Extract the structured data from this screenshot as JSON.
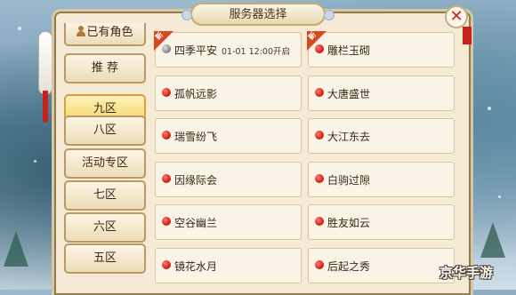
{
  "header": {
    "title": "服务器选择"
  },
  "close_symbol": "✕",
  "tabs": [
    {
      "label": "已有角色",
      "icon": "person-icon"
    },
    {
      "label": "推  荐"
    },
    {
      "label": "九区",
      "selected": true
    },
    {
      "label": "八区"
    },
    {
      "label": "活动专区"
    },
    {
      "label": "七区"
    },
    {
      "label": "六区"
    },
    {
      "label": "五区"
    }
  ],
  "servers": [
    {
      "name": "四季平安",
      "time": "01-01 12:00开启",
      "status": "gray",
      "new": true
    },
    {
      "name": "雕栏玉砌",
      "status": "red",
      "new": true
    },
    {
      "name": "孤帆远影",
      "status": "red"
    },
    {
      "name": "大唐盛世",
      "status": "red"
    },
    {
      "name": "瑞雪纷飞",
      "status": "red"
    },
    {
      "name": "大江东去",
      "status": "red"
    },
    {
      "name": "因缘际会",
      "status": "red"
    },
    {
      "name": "白驹过隙",
      "status": "red"
    },
    {
      "name": "空谷幽兰",
      "status": "red"
    },
    {
      "name": "胜友如云",
      "status": "red"
    },
    {
      "name": "镜花水月",
      "status": "red"
    },
    {
      "name": "后起之秀",
      "status": "red"
    }
  ],
  "new_badge": "新",
  "watermark": "京华手游",
  "colors": {
    "accent_red": "#c81a12",
    "selected_tab": "#f4d46a",
    "panel": "#f4ead5"
  }
}
